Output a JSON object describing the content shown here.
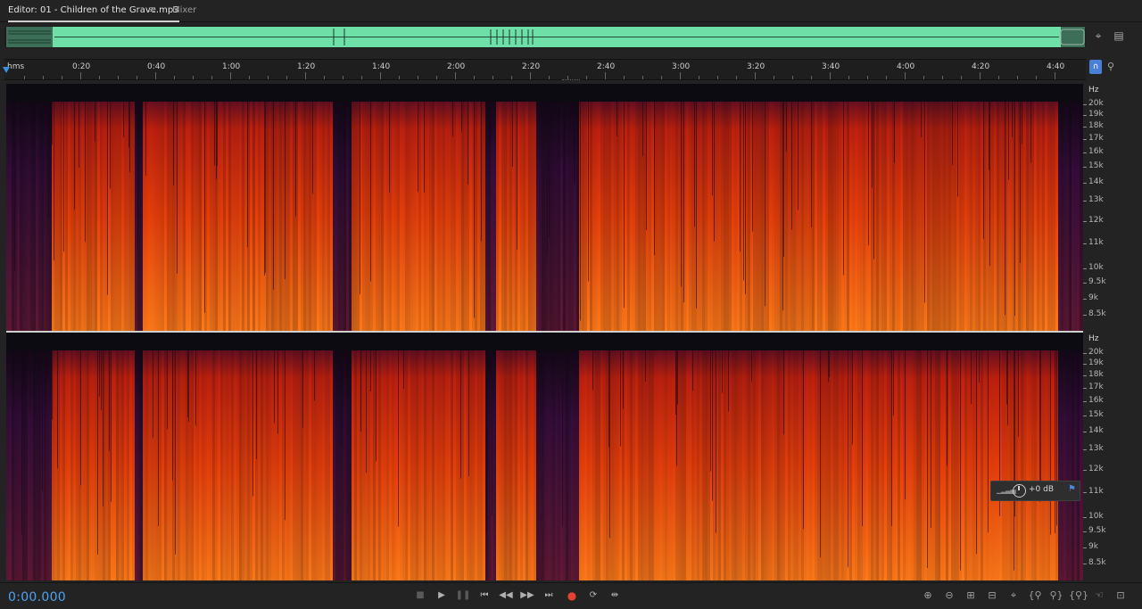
{
  "tabs": {
    "editor_label": "Editor: 01 - Children of the Grave.mp3",
    "mixer_label": "Mixer"
  },
  "ruler": {
    "format_label": "hms",
    "labels": [
      "0:20",
      "0:40",
      "1:00",
      "1:20",
      "1:40",
      "2:00",
      "2:20",
      "2:40",
      "3:00",
      "3:20",
      "3:40",
      "4:00",
      "4:20",
      "4:40"
    ]
  },
  "frequency_scale": {
    "unit": "Hz",
    "labels": [
      "20k",
      "19k",
      "18k",
      "17k",
      "16k",
      "15k",
      "14k",
      "13k",
      "12k",
      "11k",
      "10k",
      "9.5k",
      "9k",
      "8.5k"
    ]
  },
  "gain_hud": {
    "value": "+0 dB"
  },
  "status": {
    "timecode": "0:00.000"
  },
  "icons": {
    "menu": "hamburger-icon",
    "zoom_to_selection": "zoom-target-icon",
    "panel": "panel-icon",
    "snap": "magnet-icon",
    "marker": "marker-pin-icon",
    "stop": "stop-icon",
    "play": "play-icon",
    "pause": "pause-icon",
    "to_start": "skip-back-icon",
    "rewind": "rewind-icon",
    "fast_forward": "fast-forward-icon",
    "to_end": "skip-forward-icon",
    "record": "record-icon",
    "loop": "loop-icon",
    "skip_selection": "skip-selection-icon"
  },
  "colors": {
    "accent": "#4da3f0",
    "overview_waveform": "#6ee0a7",
    "record": "#e2422f",
    "spectrum_hot": "#ff5a10",
    "spectrum_cold": "#2a0a3a"
  }
}
